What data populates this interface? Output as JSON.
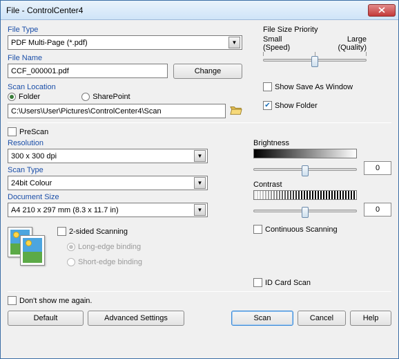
{
  "window": {
    "title": "File - ControlCenter4"
  },
  "fileType": {
    "label": "File Type",
    "value": "PDF Multi-Page (*.pdf)"
  },
  "fileSizePriority": {
    "label": "File Size Priority",
    "small": "Small",
    "large": "Large",
    "speed": "(Speed)",
    "quality": "(Quality)"
  },
  "fileName": {
    "label": "File Name",
    "value": "CCF_000001.pdf",
    "changeBtn": "Change"
  },
  "scanLocation": {
    "label": "Scan Location",
    "folderLabel": "Folder",
    "sharepointLabel": "SharePoint",
    "path": "C:\\Users\\User\\Pictures\\ControlCenter4\\Scan"
  },
  "showSaveAs": "Show Save As Window",
  "showFolder": "Show Folder",
  "preScan": "PreScan",
  "resolution": {
    "label": "Resolution",
    "value": "300 x 300 dpi"
  },
  "scanType": {
    "label": "Scan Type",
    "value": "24bit Colour"
  },
  "documentSize": {
    "label": "Document Size",
    "value": "A4 210 x 297 mm (8.3 x 11.7 in)"
  },
  "brightness": {
    "label": "Brightness",
    "value": "0"
  },
  "contrast": {
    "label": "Contrast",
    "value": "0"
  },
  "continuousScanning": "Continuous Scanning",
  "twoSided": "2-sided Scanning",
  "longEdge": "Long-edge binding",
  "shortEdge": "Short-edge binding",
  "idCardScan": "ID Card Scan",
  "dontShow": "Don't show me again.",
  "buttons": {
    "default": "Default",
    "advanced": "Advanced Settings",
    "scan": "Scan",
    "cancel": "Cancel",
    "help": "Help"
  }
}
